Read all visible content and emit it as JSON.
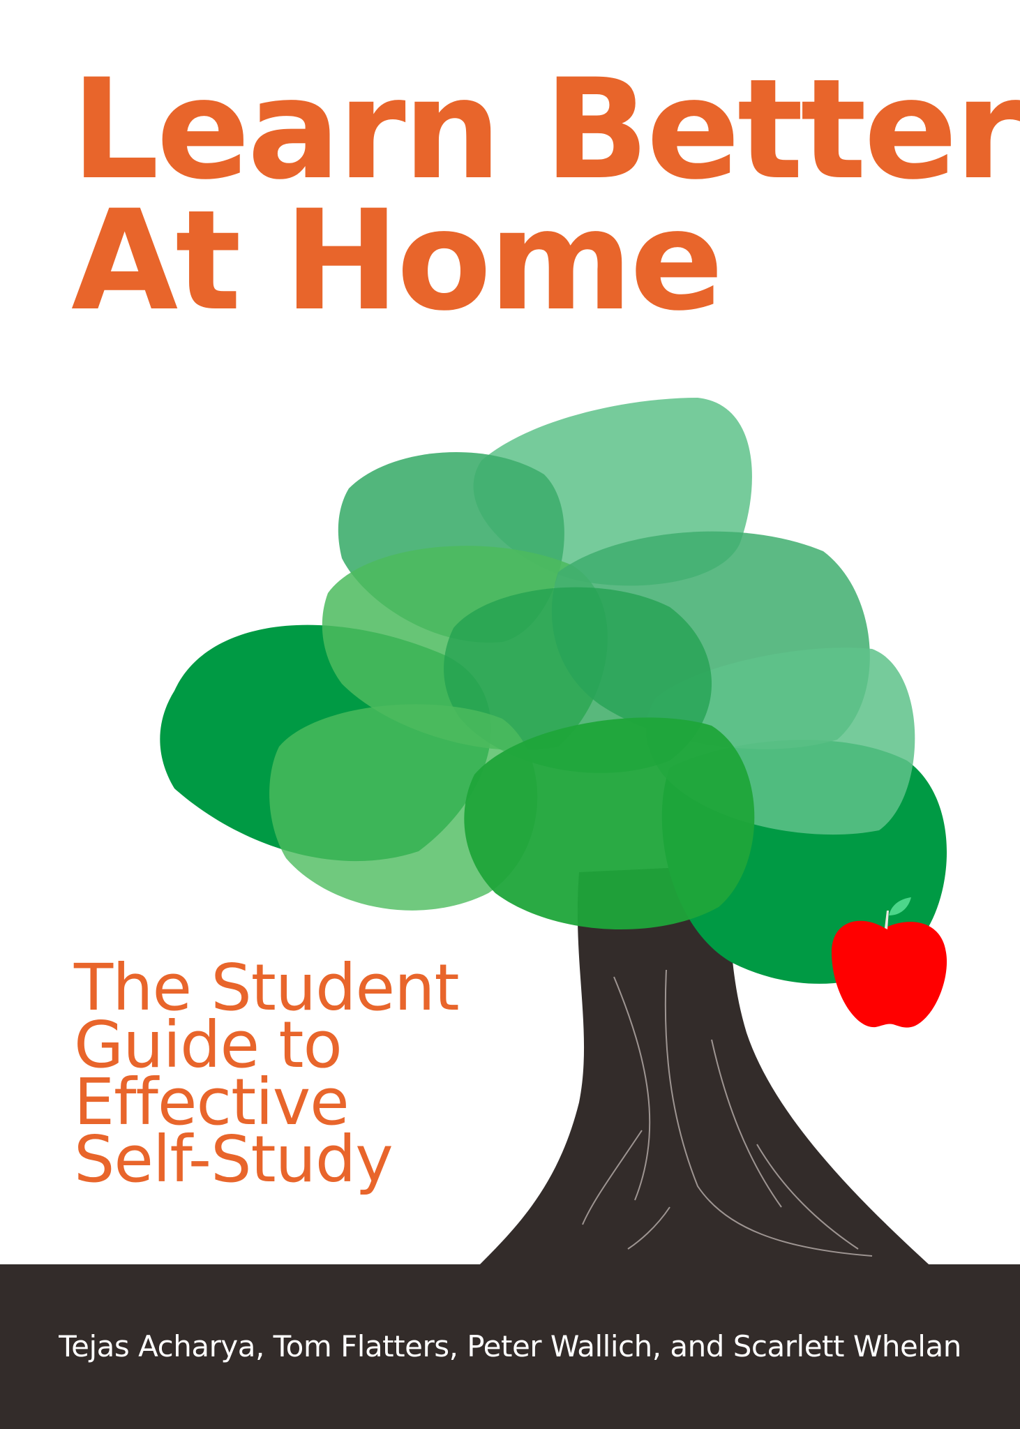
{
  "cover": {
    "title_line_1": "Learn Better",
    "title_line_2": "At Home",
    "subtitle_lines": [
      "The Student",
      "Guide to",
      "Effective",
      "Self-Study"
    ],
    "authors": "Tejas Acharya, Tom Flatters, Peter Wallich, and Scarlett Whelan"
  },
  "colors": {
    "title": "#e8652b",
    "trunk": "#332c2a",
    "foliage": [
      "#5ec28a",
      "#3fae6e",
      "#22a050",
      "#4cbb5e",
      "#009a44",
      "#1fa53a"
    ],
    "apple": "#ff0000",
    "apple_leaf": "#4cd68a"
  },
  "icons": [
    "tree-illustration",
    "apple-icon"
  ]
}
